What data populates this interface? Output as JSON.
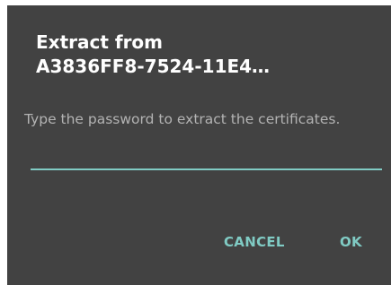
{
  "dialog": {
    "title_line1": "Extract from",
    "title_line2": "A3836FF8-7524-11E4…",
    "message": "Type the password to extract the certificates.",
    "password_field": {
      "value": "",
      "placeholder": ""
    },
    "buttons": {
      "cancel_label": "CANCEL",
      "ok_label": "OK"
    }
  },
  "colors": {
    "dialog_background": "#424242",
    "title_text": "#ffffff",
    "message_text": "#b3b3b3",
    "accent": "#80cbc4",
    "page_background": "#ffffff"
  }
}
